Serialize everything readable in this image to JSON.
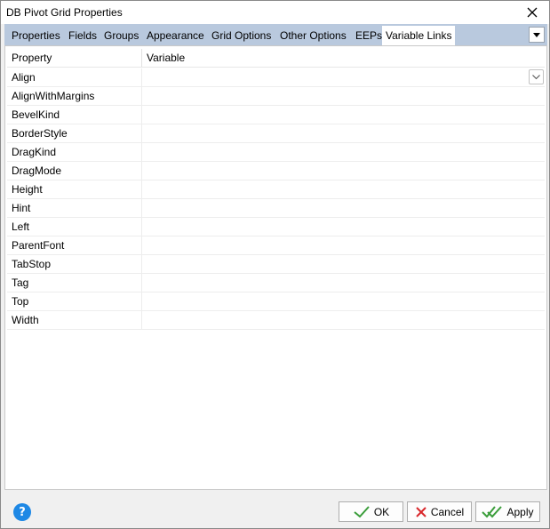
{
  "window": {
    "title": "DB Pivot Grid Properties"
  },
  "tabs": [
    {
      "label": "Properties",
      "active": false
    },
    {
      "label": "Fields",
      "active": false
    },
    {
      "label": "Groups",
      "active": false
    },
    {
      "label": "Appearance",
      "active": false
    },
    {
      "label": "Grid Options",
      "active": false
    },
    {
      "label": "Other Options",
      "active": false
    },
    {
      "label": "EEPs",
      "active": false
    },
    {
      "label": "Variable Links",
      "active": true
    }
  ],
  "grid": {
    "columns": [
      "Property",
      "Variable"
    ],
    "rows": [
      {
        "property": "Align",
        "variable": ""
      },
      {
        "property": "AlignWithMargins",
        "variable": ""
      },
      {
        "property": "BevelKind",
        "variable": ""
      },
      {
        "property": "BorderStyle",
        "variable": ""
      },
      {
        "property": "DragKind",
        "variable": ""
      },
      {
        "property": "DragMode",
        "variable": ""
      },
      {
        "property": "Height",
        "variable": ""
      },
      {
        "property": "Hint",
        "variable": ""
      },
      {
        "property": "Left",
        "variable": ""
      },
      {
        "property": "ParentFont",
        "variable": ""
      },
      {
        "property": "TabStop",
        "variable": ""
      },
      {
        "property": "Tag",
        "variable": ""
      },
      {
        "property": "Top",
        "variable": ""
      },
      {
        "property": "Width",
        "variable": ""
      }
    ]
  },
  "buttons": {
    "ok": "OK",
    "cancel": "Cancel",
    "apply": "Apply"
  },
  "icons": {
    "help": "?"
  },
  "colors": {
    "tabstrip_bg": "#b9c9de",
    "help_blue": "#1e88e5",
    "check_green": "#3a9d3a",
    "cancel_red": "#d9262a"
  }
}
